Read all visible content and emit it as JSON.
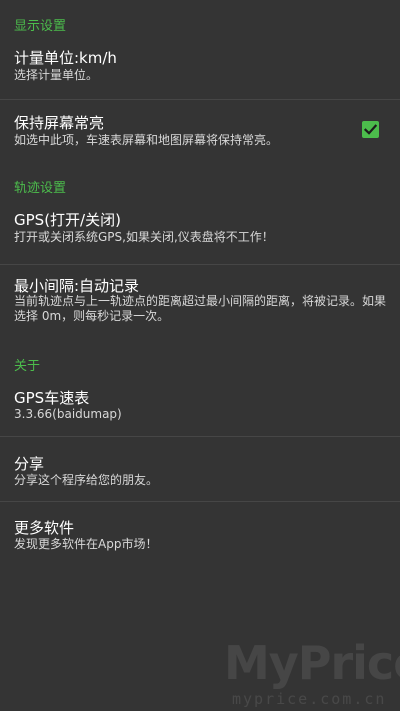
{
  "sections": {
    "display": "显示设置",
    "track": "轨迹设置",
    "about": "关于"
  },
  "items": {
    "unit": {
      "title": "计量单位:km/h",
      "summary": "选择计量单位。"
    },
    "keep_screen_on": {
      "title": "保持屏幕常亮",
      "summary": "如选中此项，车速表屏幕和地图屏幕将保持常亮。",
      "checked": true
    },
    "gps": {
      "title": "GPS(打开/关闭)",
      "summary": "打开或关闭系统GPS,如果关闭,仪表盘将不工作！"
    },
    "min_interval": {
      "title": "最小间隔:自动记录",
      "summary": "当前轨迹点与上一轨迹点的距离超过最小间隔的距离，将被记录。如果选择 0m，则每秒记录一次。"
    },
    "app": {
      "title": "GPS车速表",
      "summary": "3.3.66(baidumap)"
    },
    "share": {
      "title": "分享",
      "summary": "分享这个程序给您的朋友。"
    },
    "more_apps": {
      "title": "更多软件",
      "summary": "发现更多软件在App市场！"
    }
  },
  "colors": {
    "background": "#343434",
    "accent": "#4cbc4c",
    "divider": "#464646"
  },
  "watermark": {
    "logo": "MyPrice",
    "url": "myprice.com.cn"
  }
}
